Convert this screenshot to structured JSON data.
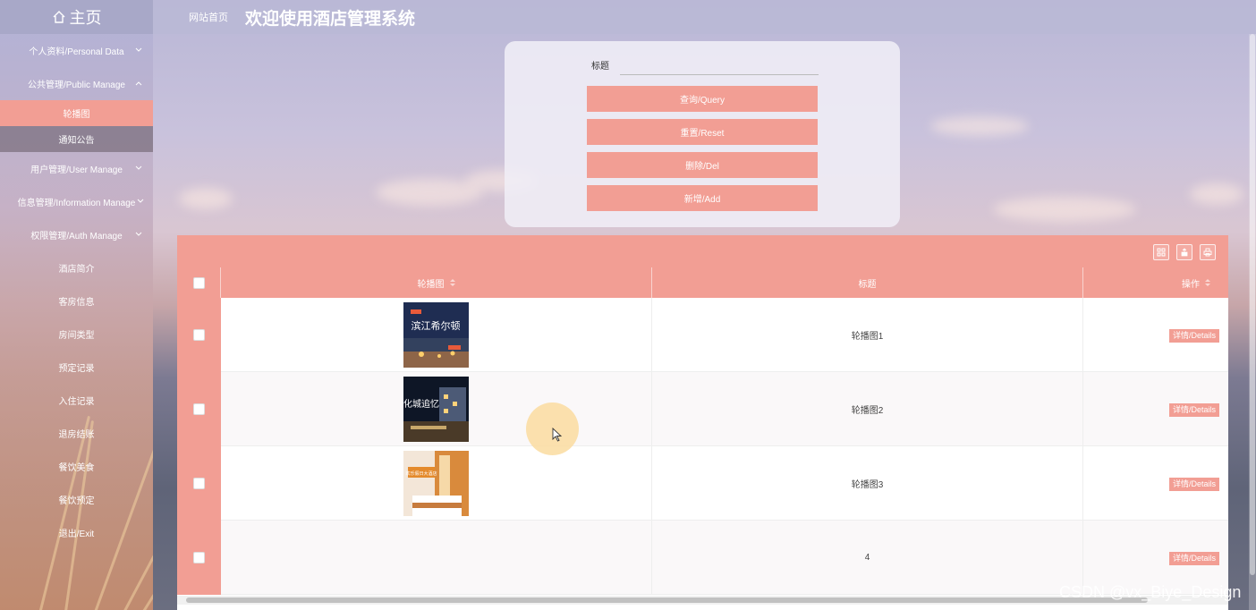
{
  "header": {
    "home_label": "主页",
    "site_link": "网站首页",
    "title": "欢迎使用酒店管理系统"
  },
  "sidebar": {
    "items": [
      {
        "label": "个人资料/Personal Data",
        "expandable": true
      },
      {
        "label": "公共管理/Public Manage",
        "expandable": true,
        "expanded": true
      },
      {
        "label": "轮播图",
        "active": true
      },
      {
        "label": "通知公告"
      },
      {
        "label": "用户管理/User Manage",
        "expandable": true
      },
      {
        "label": "信息管理/Information Manage",
        "expandable": true
      },
      {
        "label": "权限管理/Auth Manage",
        "expandable": true
      },
      {
        "label": "酒店简介"
      },
      {
        "label": "客房信息"
      },
      {
        "label": "房间类型"
      },
      {
        "label": "预定记录"
      },
      {
        "label": "入住记录"
      },
      {
        "label": "退房结账"
      },
      {
        "label": "餐饮美食"
      },
      {
        "label": "餐饮预定"
      },
      {
        "label": "退出/Exit"
      }
    ]
  },
  "search": {
    "title_label": "标题",
    "title_value": "",
    "query_button": "查询/Query",
    "reset_button": "重置/Reset",
    "delete_button": "删除/Del",
    "add_button": "新增/Add"
  },
  "table": {
    "columns": [
      "轮播图",
      "标题",
      "操作"
    ],
    "rows": [
      {
        "image": "hotel-banner-1",
        "title": "轮播图1",
        "action": "详情/Details",
        "img_text": "滨江希尔顿"
      },
      {
        "image": "hotel-banner-2",
        "title": "轮播图2",
        "action": "详情/Details",
        "img_text": "化城追忆"
      },
      {
        "image": "hotel-banner-3",
        "title": "轮播图3",
        "action": "详情/Details",
        "img_text": "欢乐假日大酒店"
      },
      {
        "image": "",
        "title": "4",
        "action": "详情/Details"
      }
    ]
  },
  "watermark": "CSDN @vx_Biye_Design",
  "colors": {
    "accent": "#f29e94",
    "header_bg": "#a8a8c8"
  }
}
